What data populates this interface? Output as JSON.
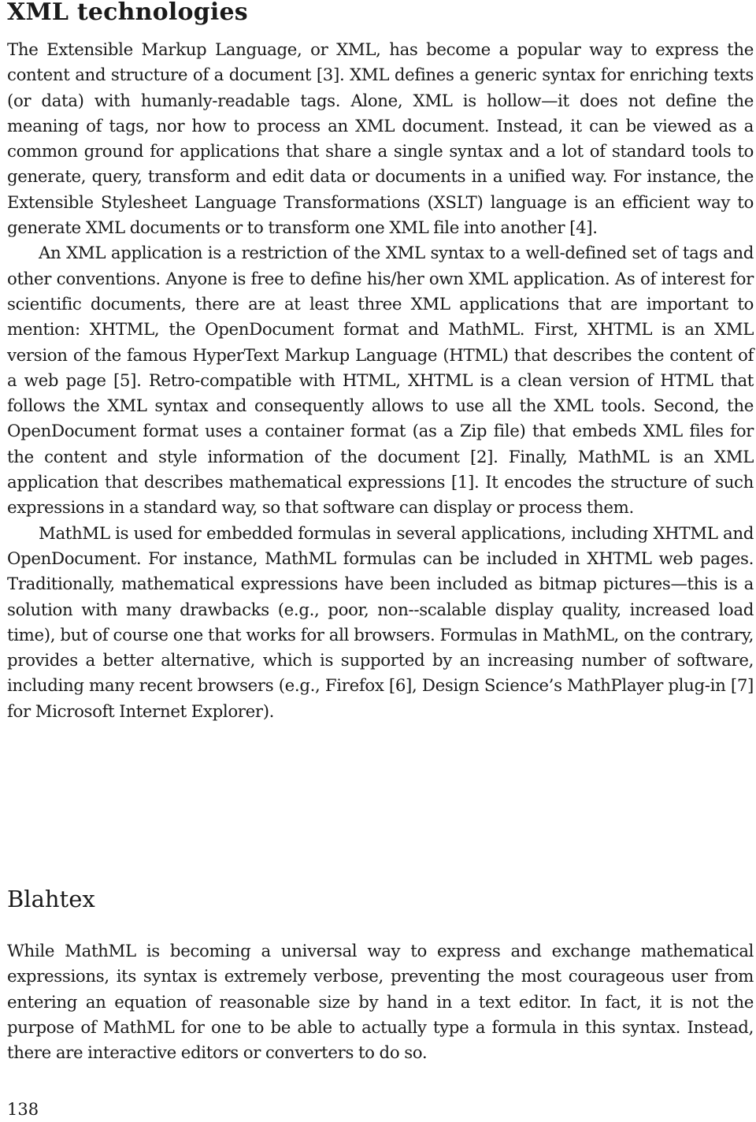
{
  "sections": [
    {
      "heading": "XML technologies",
      "paragraphs": [
        "The Extensible Markup Language, or XML, has become a popular way to express the content and structure of a document [3]. XML defines a generic syntax for enriching texts (or data) with humanly-readable tags. Alone, XML is hollow—it does not define the meaning of tags, nor how to process an XML document. Instead, it can be viewed as a common ground for applications that share a single syntax and a lot of standard tools to generate, query, transform and edit data or documents in a unified way. For instance, the Extensible Stylesheet Language Transformations (XSLT) language is an efficient way to generate XML documents or to transform one XML file into another [4].",
        "An XML application is a restriction of the XML syntax to a well-defined set of tags and other conventions. Anyone is free to define his/her own XML application. As of interest for scientific documents, there are at least three XML applications that are important to mention: XHTML, the OpenDocument format and MathML. First, XHTML is an XML version of the famous HyperText Markup Language (HTML) that describes the content of a web page [5]. Retro-compatible with HTML, XHTML is a clean version of HTML that follows the XML syntax and consequently allows to use all the XML tools. Second, the OpenDocument format uses a container format (as a Zip file) that embeds XML files for the content and style information of the document [2]. Finally, MathML is an XML application that describes mathematical expressions [1]. It encodes the structure of such expressions in a standard way, so that software can display or process them.",
        "MathML is used for embedded formulas in several applications, including XHTML and OpenDocument. For instance, MathML formulas can be included in XHTML web pages. Traditionally, mathematical expressions have been included as bitmap pictures—this is a solution with many drawbacks (e.g., poor, non--scalable display quality, increased load time), but of course one that works for all browsers. Formulas in MathML, on the contrary, provides a better alternative, which is supported by an increasing number of software, including many recent browsers (e.g., Firefox [6], Design Science’s MathPlayer plug-in [7] for Microsoft Internet Explorer)."
      ]
    },
    {
      "heading": "Blahtex",
      "paragraphs": [
        "While MathML is becoming a universal way to express and exchange mathematical expressions, its syntax is extremely verbose, preventing the most courageous user from entering an equation of reasonable size by hand in a text editor. In fact, it is not the purpose of MathML for one to be able to actually type a formula in this syntax. Instead, there are interactive editors or converters to do so."
      ]
    }
  ],
  "page_number": "138"
}
